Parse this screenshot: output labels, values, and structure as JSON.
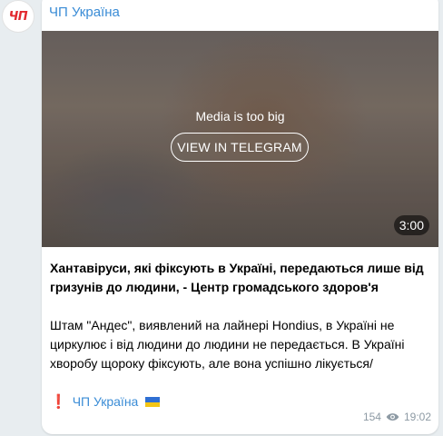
{
  "channel": {
    "name": "ЧП Україна",
    "avatar_text": "ЧП"
  },
  "media": {
    "notice": "Media is too big",
    "button_label": "VIEW IN TELEGRAM",
    "duration": "3:00"
  },
  "post": {
    "headline": "Хантавіруси, які фіксують в Україні, передаються лише від гризунів до людини, - Центр громадського здоров'я",
    "paragraph": "Штам \"Андес\", виявлений на лайнері Hondius, в Україні не циркулює і від людини до людини не передається. В Україні хворобу щороку фіксують, але вона успішно лікується/",
    "signature_mark": "❗",
    "signature_link": "ЧП Україна"
  },
  "meta": {
    "views": "154",
    "time": "19:02"
  },
  "icons": {
    "avatar": "channel-logo",
    "views": "eye-icon",
    "flag": "ukraine-flag-icon"
  },
  "colors": {
    "link": "#3a8cd6",
    "background": "#e8edf0",
    "bubble": "#ffffff",
    "meta": "#8d9aa4",
    "logo": "#e2282e"
  }
}
